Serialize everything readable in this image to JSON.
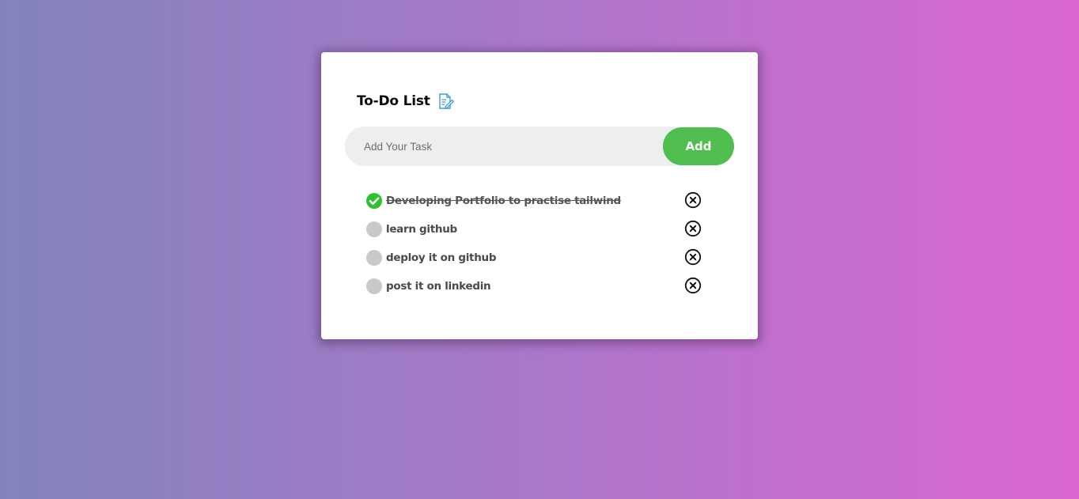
{
  "app": {
    "title": "To-Do List",
    "title_icon": "edit-note-icon"
  },
  "input": {
    "placeholder": "Add Your Task",
    "value": "",
    "add_label": "Add"
  },
  "colors": {
    "accent_green": "#4fbe4f",
    "done_check": "#2fc12f",
    "pending_check": "#c9c9cb",
    "title_icon": "#3a9fdc"
  },
  "tasks": [
    {
      "text": "Developing Portfolio to practise tailwind",
      "done": true
    },
    {
      "text": "learn github",
      "done": false
    },
    {
      "text": "deploy it on github",
      "done": false
    },
    {
      "text": "post it on linkedin",
      "done": false
    }
  ]
}
